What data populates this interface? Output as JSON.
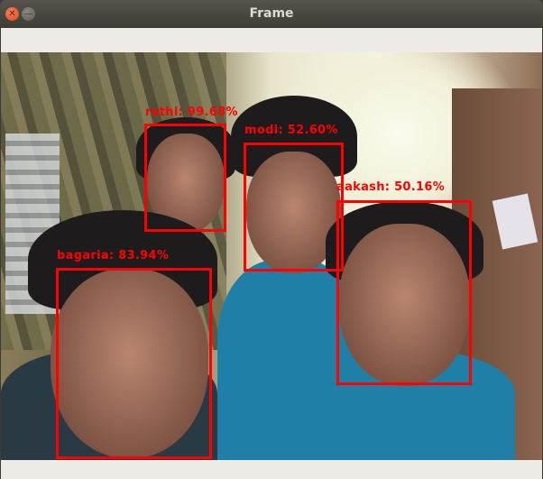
{
  "window": {
    "title": "Frame",
    "close_icon": "close-icon",
    "minimize_icon": "minimize-icon"
  },
  "box_color": "#ff0000",
  "detections": [
    {
      "name": "rathi",
      "label": "rathi: 99.68%",
      "confidence": 99.68
    },
    {
      "name": "modi",
      "label": "modi: 52.60%",
      "confidence": 52.6
    },
    {
      "name": "aakash",
      "label": "aakash: 50.16%",
      "confidence": 50.16
    },
    {
      "name": "bagaria",
      "label": "bagaria: 83.94%",
      "confidence": 83.94
    }
  ]
}
